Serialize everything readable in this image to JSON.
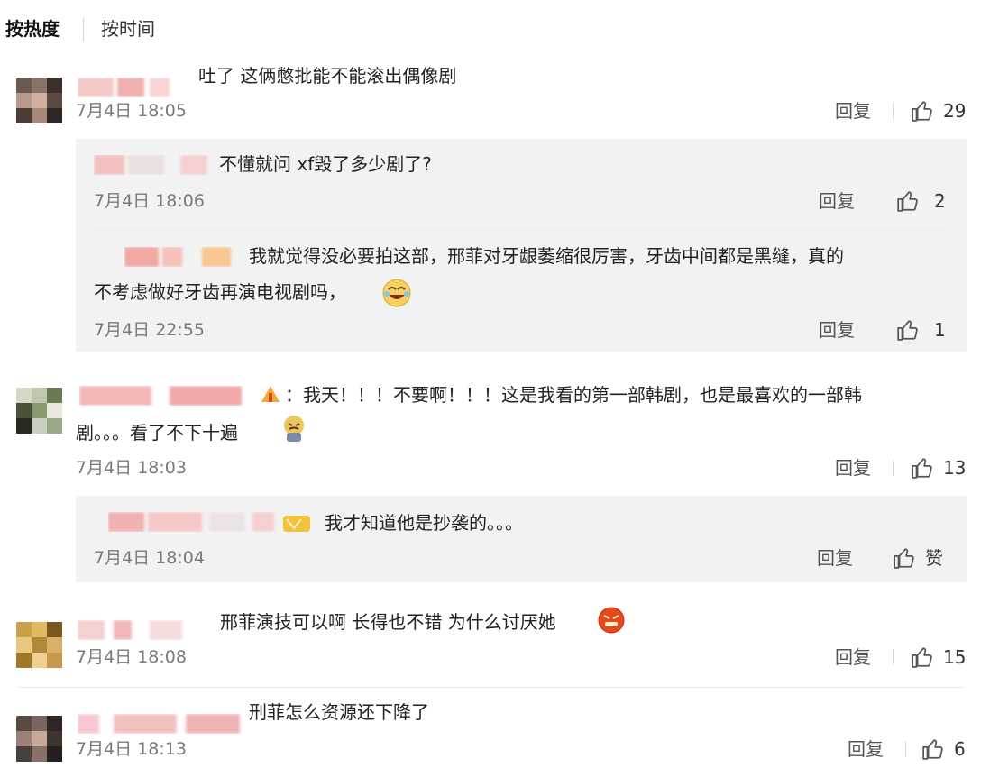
{
  "sort_tabs": {
    "hot": "按热度",
    "time": "按时间"
  },
  "comments": [
    {
      "text": "吐了 这俩憋批能不能滚出偶像剧",
      "time": "7月4日 18:05",
      "reply_label": "回复",
      "likes": "29",
      "replies": [
        {
          "text": "不懂就问 xf毁了多少剧了?",
          "time": "7月4日 18:06",
          "reply_label": "回复",
          "likes": "2"
        },
        {
          "text_line1": "我就觉得没必要拍这部，邢菲对牙龈萎缩很厉害，牙齿中间都是黑缝，真的",
          "text_line2": "不考虑做好牙齿再演电视剧吗，",
          "time": "7月4日 22:55",
          "reply_label": "回复",
          "likes": "1"
        }
      ]
    },
    {
      "text_line1": "：我天！！！不要啊！！！这是我看的第一部韩剧，也是最喜欢的一部韩",
      "text_line2": "剧。。。看了不下十遍",
      "time": "7月4日 18:03",
      "reply_label": "回复",
      "likes": "13",
      "replies": [
        {
          "text": "我才知道他是抄袭的。。。",
          "time": "7月4日 18:04",
          "reply_label": "回复",
          "likes": "赞"
        }
      ]
    },
    {
      "text": "邢菲演技可以啊 长得也不错 为什么讨厌她",
      "time": "7月4日 18:08",
      "reply_label": "回复",
      "likes": "15"
    },
    {
      "text": "刑菲怎么资源还下降了",
      "time": "7月4日 18:13",
      "reply_label": "回复",
      "likes": "6"
    }
  ],
  "colors": {
    "panel_bg": "#f2f2f2",
    "time": "#7a7a7a",
    "blurred_name": "#f0b8b8"
  },
  "icons": {
    "like": "thumbs-up-icon",
    "laugh": "laughing-emoji-icon",
    "cry": "crying-emoji-icon"
  }
}
